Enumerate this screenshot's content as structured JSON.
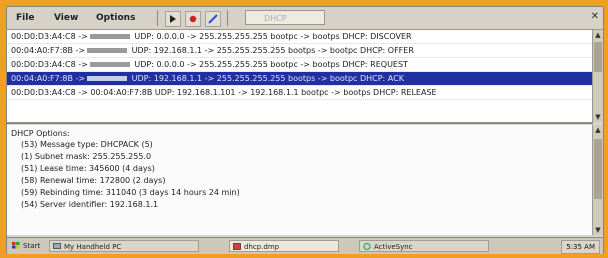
{
  "menu": {
    "file": "File",
    "view": "View",
    "options": "Options"
  },
  "toolbar": {
    "filter_placeholder": "DHCP"
  },
  "packets": [
    {
      "src": "00:D0:D3:A4:C8 ->",
      "text": "UDP: 0.0.0.0 -> 255.255.255.255 bootpc -> bootps DHCP: DISCOVER"
    },
    {
      "src": "00:04:A0:F7:8B ->",
      "text": "UDP: 192.168.1.1 -> 255.255.255.255 bootps -> bootpc DHCP: OFFER"
    },
    {
      "src": "00:D0:D3:A4:C8 ->",
      "text": "UDP: 0.0.0.0 -> 255.255.255.255 bootpc -> bootps DHCP: REQUEST"
    },
    {
      "src": "00:04:A0:F7:8B ->",
      "text": "UDP: 192.168.1.1 -> 255.255.255.255 bootps -> bootpc DHCP: ACK"
    },
    {
      "src": "00:D0:D3:A4:C8 -> 00:04:A0:F7:8B",
      "text": "UDP: 192.168.1.101 -> 192.168.1.1 bootpc -> bootps DHCP: RELEASE"
    }
  ],
  "details": {
    "header": "DHCP Options:",
    "options": [
      "(53) Message type: DHCPACK (5)",
      "(1) Subnet mask: 255.255.255.0",
      "(51) Lease time: 345600 (4 days)",
      "(58) Renewal time: 172800 (2 days)",
      "(59) Rebinding time: 311040 (3 days 14 hours 24 min)",
      "(54) Server identifier: 192.168.1.1"
    ]
  },
  "taskbar": {
    "start": "Start",
    "t1": "My Handheld PC",
    "t2": "dhcp.dmp",
    "t3": "ActiveSync",
    "clock": "5:35 AM"
  }
}
